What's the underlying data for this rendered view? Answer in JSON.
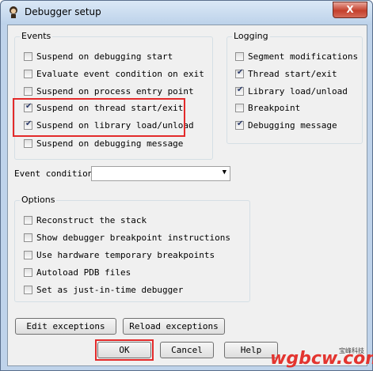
{
  "window": {
    "title": "Debugger setup",
    "close_label": "X"
  },
  "events": {
    "label": "Events",
    "items": [
      {
        "label": "Suspend on debugging start",
        "checked": false
      },
      {
        "label": "Evaluate event condition on exit",
        "checked": false
      },
      {
        "label": "Suspend on process entry point",
        "checked": false
      },
      {
        "label": "Suspend on thread start/exit",
        "checked": true
      },
      {
        "label": "Suspend on library load/unload",
        "checked": true
      },
      {
        "label": "Suspend on debugging message",
        "checked": false
      }
    ]
  },
  "logging": {
    "label": "Logging",
    "items": [
      {
        "label": "Segment modifications",
        "checked": false
      },
      {
        "label": "Thread start/exit",
        "checked": true
      },
      {
        "label": "Library load/unload",
        "checked": true
      },
      {
        "label": "Breakpoint",
        "checked": false
      },
      {
        "label": "Debugging message",
        "checked": true
      }
    ]
  },
  "event_condition": {
    "label": "Event condition",
    "value": ""
  },
  "options": {
    "label": "Options",
    "items": [
      {
        "label": "Reconstruct the stack",
        "checked": false
      },
      {
        "label": "Show debugger breakpoint instructions",
        "checked": false
      },
      {
        "label": "Use hardware temporary breakpoints",
        "checked": false
      },
      {
        "label": "Autoload PDB files",
        "checked": false
      },
      {
        "label": "Set as just-in-time debugger",
        "checked": false
      }
    ]
  },
  "buttons": {
    "edit_exceptions": "Edit exceptions",
    "reload_exceptions": "Reload exceptions",
    "ok": "OK",
    "cancel": "Cancel",
    "help": "Help"
  },
  "watermark": {
    "text": "wgbcw.com",
    "sub": "宝峰科技"
  }
}
